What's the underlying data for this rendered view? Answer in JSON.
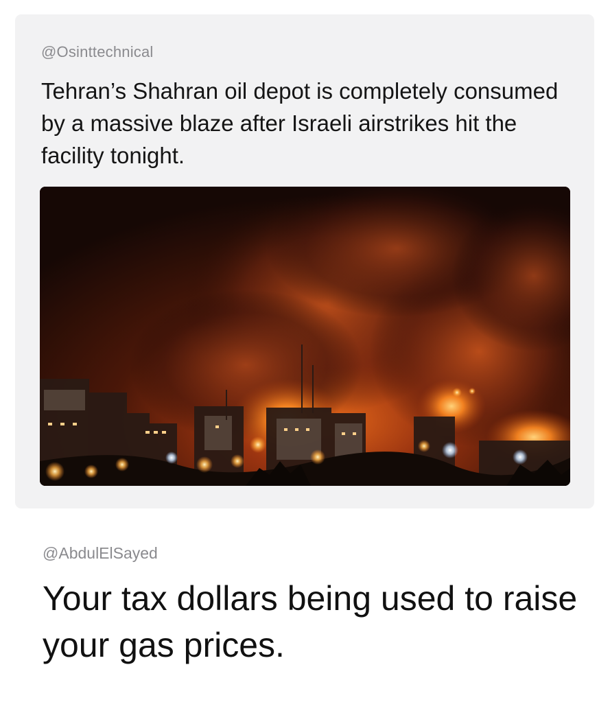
{
  "quoted_post": {
    "handle": "@Osinttechnical",
    "text": "Tehran’s Shahran oil depot is completely consumed by a massive blaze after Israeli airstrikes hit the facility tonight.",
    "image_icon": "photo-fire-night-cityscape"
  },
  "reply_post": {
    "handle": "@AbdulElSayed",
    "text": "Your tax dollars being used to raise your gas prices."
  },
  "colors": {
    "card_background": "#f2f2f3",
    "handle_gray": "#8a8a8e",
    "text_dark": "#111111"
  }
}
